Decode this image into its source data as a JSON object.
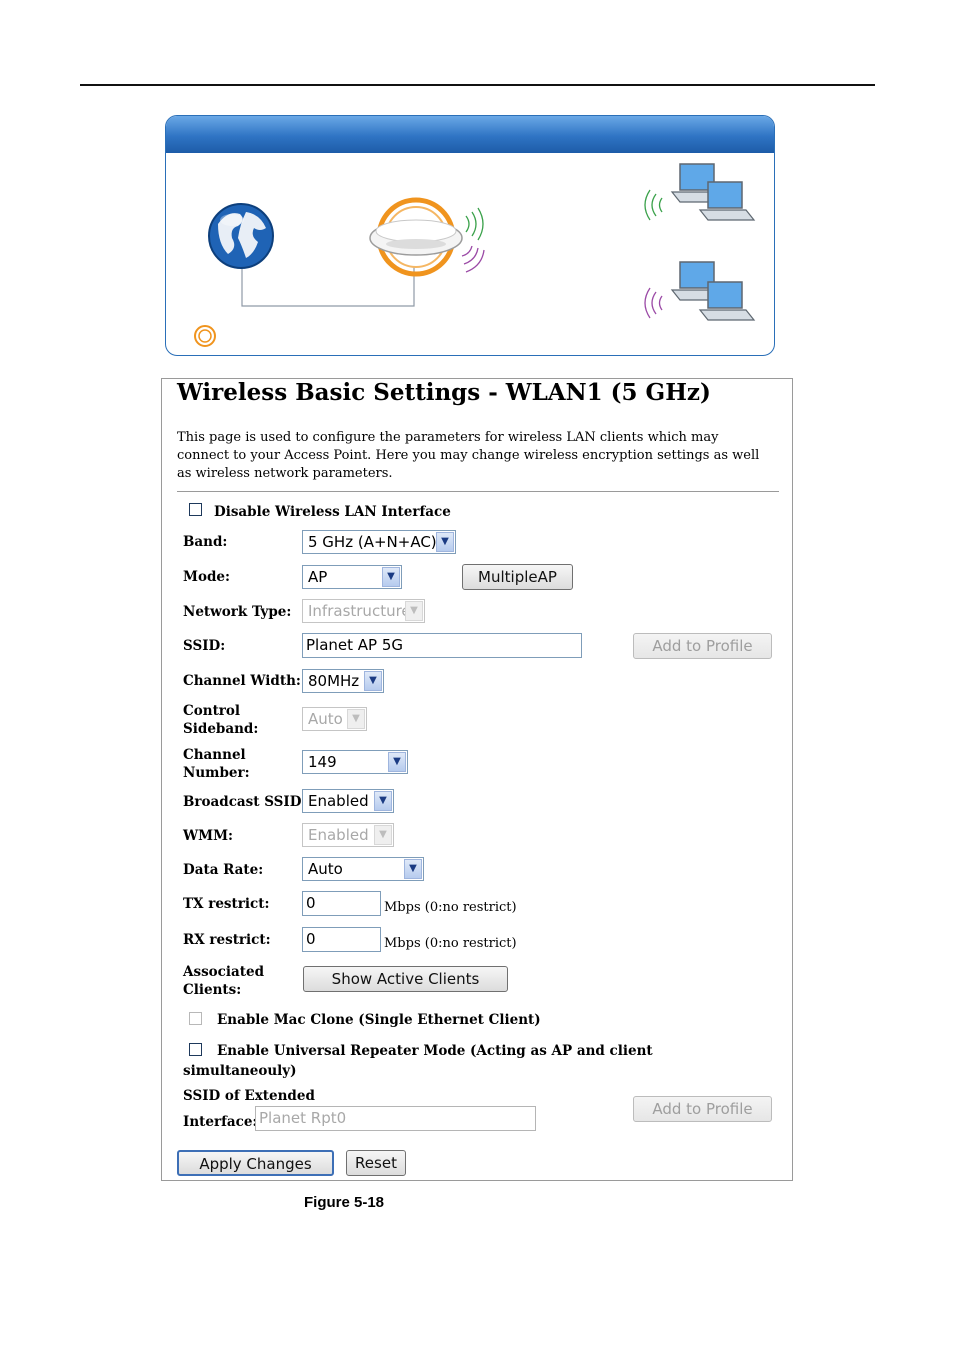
{
  "page": {
    "title": "Wireless Basic Settings - WLAN1 (5 GHz)",
    "description": "This page is used to configure the parameters for wireless LAN clients which may connect to your Access Point. Here you may change wireless encryption settings as well as wireless network parameters.",
    "figure_caption": "Figure 5-18"
  },
  "form": {
    "disable_wlan_label": "Disable Wireless LAN Interface",
    "band": {
      "label": "Band:",
      "value": "5 GHz (A+N+AC)"
    },
    "mode": {
      "label": "Mode:",
      "value": "AP",
      "multiple_ap_label": "MultipleAP"
    },
    "network_type": {
      "label": "Network Type:",
      "value": "Infrastructure"
    },
    "ssid": {
      "label": "SSID:",
      "value": "Planet AP 5G",
      "add_profile_label": "Add to Profile"
    },
    "channel_width": {
      "label": "Channel Width:",
      "value": "80MHz"
    },
    "control_sideband": {
      "label_line1": "Control",
      "label_line2": "Sideband:",
      "value": "Auto"
    },
    "channel_number": {
      "label_line1": "Channel",
      "label_line2": "Number:",
      "value": "149"
    },
    "broadcast_ssid": {
      "label": "Broadcast SSID:",
      "value": "Enabled"
    },
    "wmm": {
      "label": "WMM:",
      "value": "Enabled"
    },
    "data_rate": {
      "label": "Data Rate:",
      "value": "Auto"
    },
    "tx_restrict": {
      "label": "TX restrict:",
      "value": "0",
      "unit": "Mbps (0:no restrict)"
    },
    "rx_restrict": {
      "label": "RX restrict:",
      "value": "0",
      "unit": "Mbps (0:no restrict)"
    },
    "associated_clients": {
      "label_line1": "Associated",
      "label_line2": "Clients:",
      "button_label": "Show Active Clients"
    },
    "mac_clone_label": "Enable Mac Clone (Single Ethernet Client)",
    "repeater_label_line1": "Enable Universal Repeater Mode (Acting as AP and client",
    "repeater_label_line2": "simultaneouly)",
    "extended_ssid": {
      "label_line1": "SSID of Extended",
      "label_line2": "Interface:",
      "value": "Planet Rpt0",
      "add_profile_label": "Add to Profile"
    },
    "apply_label": "Apply Changes",
    "reset_label": "Reset"
  },
  "icons": {
    "globe": "globe-icon",
    "access_point": "access-point-icon",
    "laptops": "laptop-icon",
    "signal": "wifi-signal-icon"
  },
  "colors": {
    "banner_blue": "#2f74c4",
    "ap_orange": "#f0941e",
    "wave_green": "#3aa14a",
    "wave_purple": "#9b4aa6"
  }
}
